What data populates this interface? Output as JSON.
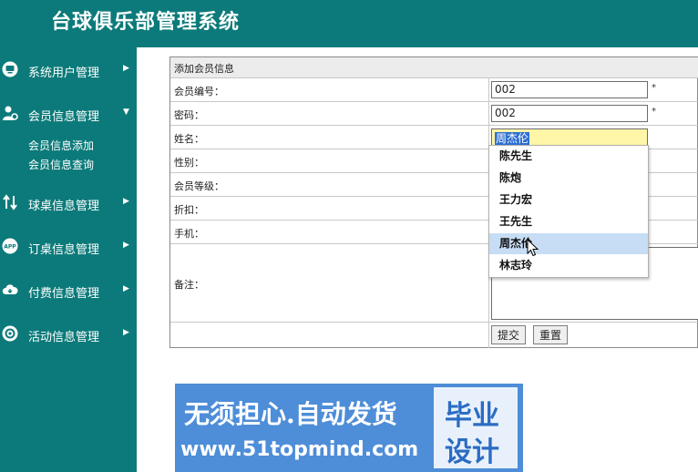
{
  "app": {
    "title": "台球俱乐部管理系统"
  },
  "sidebar": {
    "items": [
      {
        "label": "系统用户管理",
        "icon": "monitor-icon"
      },
      {
        "label": "会员信息管理",
        "icon": "user-settings-icon",
        "expanded": true,
        "children": [
          "会员信息添加",
          "会员信息查询"
        ]
      },
      {
        "label": "球桌信息管理",
        "icon": "swap-icon"
      },
      {
        "label": "订桌信息管理",
        "icon": "app-icon"
      },
      {
        "label": "付费信息管理",
        "icon": "cloud-icon"
      },
      {
        "label": "活动信息管理",
        "icon": "gear-icon"
      }
    ]
  },
  "form": {
    "title": "添加会员信息",
    "fields": {
      "member_no": {
        "label": "会员编号：",
        "value": "002",
        "required_mark": "*"
      },
      "password": {
        "label": "密码：",
        "value": "002",
        "required_mark": "*"
      },
      "name": {
        "label": "姓名：",
        "value": "周杰伦"
      },
      "gender": {
        "label": "性别："
      },
      "level": {
        "label": "会员等级："
      },
      "discount": {
        "label": "折扣："
      },
      "phone": {
        "label": "手机："
      },
      "remark": {
        "label": "备注："
      }
    },
    "buttons": {
      "submit": "提交",
      "reset": "重置"
    }
  },
  "autocomplete": {
    "options": [
      "陈先生",
      "陈炮",
      "王力宏",
      "王先生",
      "周杰伦",
      "林志玲"
    ],
    "highlighted_index": 4
  },
  "watermark": {
    "line1": "无须担心.自动发货",
    "line2": "www.51topmind.com",
    "box_line1": "毕业",
    "box_line2": "设计"
  },
  "colors": {
    "header_bg": "#0c7a7a",
    "highlight": "#c7ddf5",
    "banner_bg": "#4e8dd8"
  }
}
